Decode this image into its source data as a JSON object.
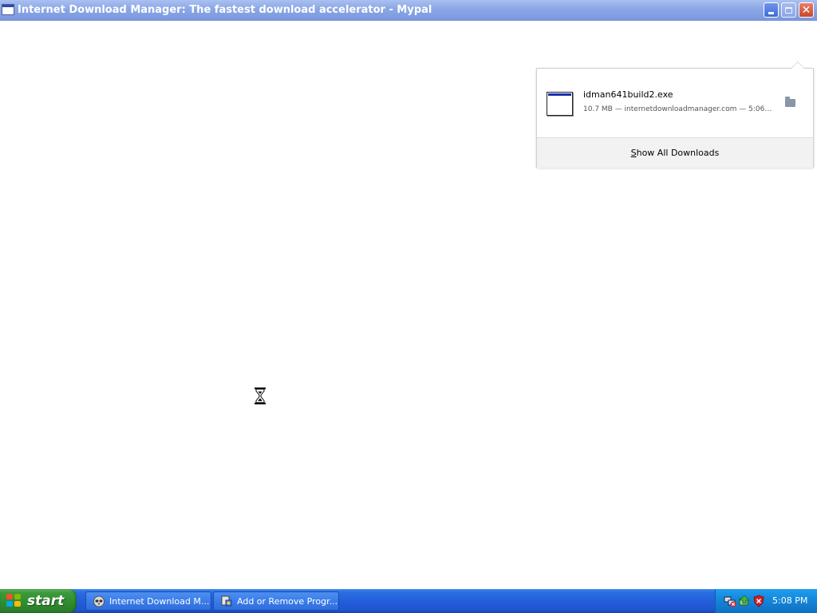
{
  "window": {
    "title": "Internet Download Manager: The fastest download accelerator - Mypal"
  },
  "downloads_panel": {
    "item": {
      "file_name": "idman641build2.exe",
      "meta": "10.7 MB — internetdownloadmanager.com — 5:06 ..."
    },
    "show_all_prefix": "S",
    "show_all_rest": "how All Downloads"
  },
  "taskbar": {
    "start_label": "start",
    "tasks": [
      {
        "label": "Internet Download M...",
        "icon": "mypal-raccoon-icon"
      },
      {
        "label": "Add or Remove Progr...",
        "icon": "add-remove-programs-icon"
      }
    ],
    "tray": {
      "icons": [
        "network-disconnected-icon",
        "safely-remove-hardware-icon",
        "security-alert-icon"
      ],
      "time": "5:08 PM"
    }
  },
  "colors": {
    "title_bar": "#8aa6e6",
    "taskbar": "#245edb",
    "start_button": "#3c9a3c",
    "tray": "#1484d8"
  }
}
